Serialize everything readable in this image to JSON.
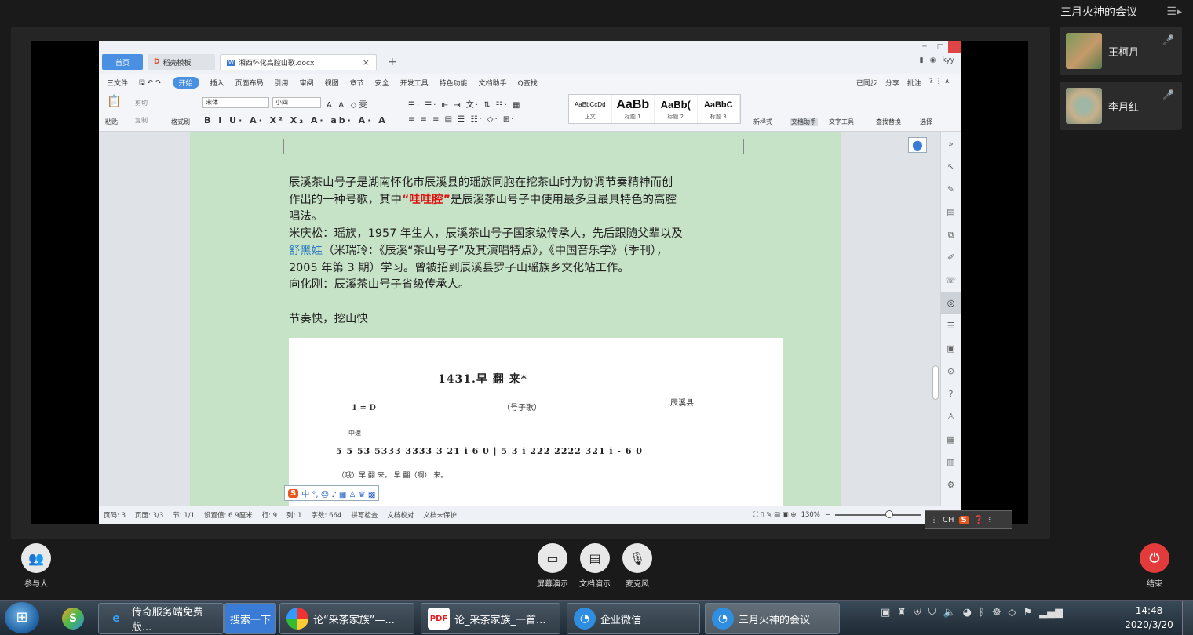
{
  "meeting": {
    "title": "三月火神的会议",
    "participants": [
      {
        "name": "王柯月",
        "mic": "on"
      },
      {
        "name": "李月红",
        "mic": "speaking"
      }
    ],
    "controls": {
      "participants_label": "参与人",
      "screen_share_label": "屏幕演示",
      "doc_share_label": "文档演示",
      "mic_label": "麦克风",
      "end_label": "结束"
    }
  },
  "wps": {
    "tabs": {
      "home": "首页",
      "template": "稻壳模板",
      "document": "湘西怀化高腔山歌.docx",
      "user": "kyy"
    },
    "menu": {
      "file": "三文件",
      "items": [
        "开始",
        "插入",
        "页面布局",
        "引用",
        "审阅",
        "视图",
        "章节",
        "安全",
        "开发工具",
        "特色功能",
        "文档助手",
        "Q查找"
      ],
      "right": [
        "已同步",
        "分享",
        "批注"
      ]
    },
    "ribbon": {
      "paste": "粘贴",
      "cut": "剪切",
      "copy": "复制",
      "format_painter": "格式刷",
      "font": "宋体",
      "size": "小四",
      "styles": [
        {
          "preview": "AaBbCcDd",
          "label": "正文"
        },
        {
          "preview": "AaBb",
          "label": "标题 1"
        },
        {
          "preview": "AaBb(",
          "label": "标题 2"
        },
        {
          "preview": "AaBbC",
          "label": "标题 3"
        }
      ],
      "new_style": "新样式",
      "doc_assistant": "文档助手",
      "text_tools": "文字工具",
      "find_replace": "查找替换",
      "select": "选择"
    },
    "body": {
      "line1": "辰溪茶山号子是湖南怀化市辰溪县的瑶族同胞在挖茶山时为协调节奏精神而创",
      "line2_pre": "作出的一种号歌，其中",
      "line2_red": "“哇哇腔”",
      "line2_post": "是辰溪茶山号子中使用最多且最具特色的高腔",
      "line3": "唱法。",
      "line4": "米庆松：瑶族，1957 年生人，辰溪茶山号子国家级传承人，先后跟随父辈以及",
      "line5_blue": "舒黑娃",
      "line5_post": "（米瑞玲：《辰溪“茶山号子”及其演唱特点》，《中国音乐学》（季刊），",
      "line6": "2005 年第 3 期）学习。曾被招到辰溪县罗子山瑶族乡文化站工作。",
      "line7": "向化刚：辰溪茶山号子省级传承人。",
      "line8": "节奏快，挖山快"
    },
    "score": {
      "title": "1431.早    翻    来*",
      "key": "1 = D",
      "genre": "（号子歌）",
      "region": "辰溪县",
      "tempo": "中速",
      "notes": "5 5 53 5333 3333 3 21 i 6 0 | 5 3 i 222 2222 321 i - 6 0",
      "lyrics": "（哦）早 翻   来。                    早    翻（啊）    来。"
    },
    "ime_bar": "中 °, ☺ ♪ ▦ ♙ ♛ ▩",
    "status": {
      "page": "页码: 3",
      "pages": "页面: 3/3",
      "section": "节: 1/1",
      "position": "设置值: 6.9厘米",
      "row": "行: 9",
      "col": "列: 1",
      "words": "字数: 664",
      "spell": "拼写检查",
      "proof": "文档校对",
      "protect": "文档未保护",
      "zoom": "130%"
    }
  },
  "langbar": {
    "text": "CH"
  },
  "taskbar": {
    "items": [
      {
        "label": "传奇服务端免费版...",
        "icon": "ie-icon"
      },
      {
        "label": "搜索一下",
        "icon": "none"
      },
      {
        "label": "论“采茶家族”—...",
        "icon": "browser-icon"
      },
      {
        "label": "论_采茶家族_一首...",
        "icon": "pdf-icon"
      },
      {
        "label": "企业微信",
        "icon": "wework-icon"
      },
      {
        "label": "三月火神的会议",
        "icon": "wework-icon"
      }
    ],
    "time": "14:48",
    "date": "2020/3/20"
  },
  "colors": {
    "page_bg": "#c7e3c7",
    "accent": "#4a90e2",
    "end_red": "#e33b3b",
    "speaking_green": "#27c24c"
  }
}
